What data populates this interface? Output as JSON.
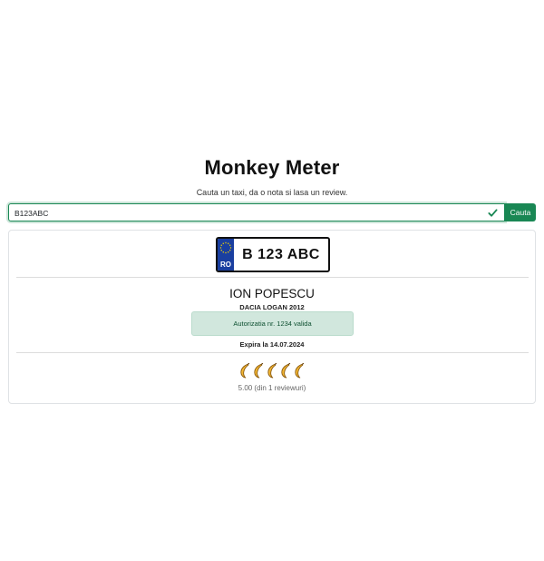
{
  "header": {
    "title": "Monkey Meter",
    "subtitle": "Cauta un taxi, da o nota si lasa un review."
  },
  "search": {
    "value": "B123ABC",
    "button_label": "Cauta",
    "valid_icon": "check-icon",
    "accent_color": "#198754"
  },
  "result": {
    "plate": {
      "country_code": "RO",
      "number": "B 123 ABC",
      "band_color": "#1a3fa0"
    },
    "driver_name": "ION POPESCU",
    "car_model": "DACIA LOGAN 2012",
    "authorization": "Autorizatia nr. 1234 valida",
    "expiry": "Expira la 14.07.2024",
    "rating": {
      "icon": "banana-icon",
      "score_out_of_5": 5,
      "text": "5.00 (din 1 reviewuri)"
    }
  }
}
